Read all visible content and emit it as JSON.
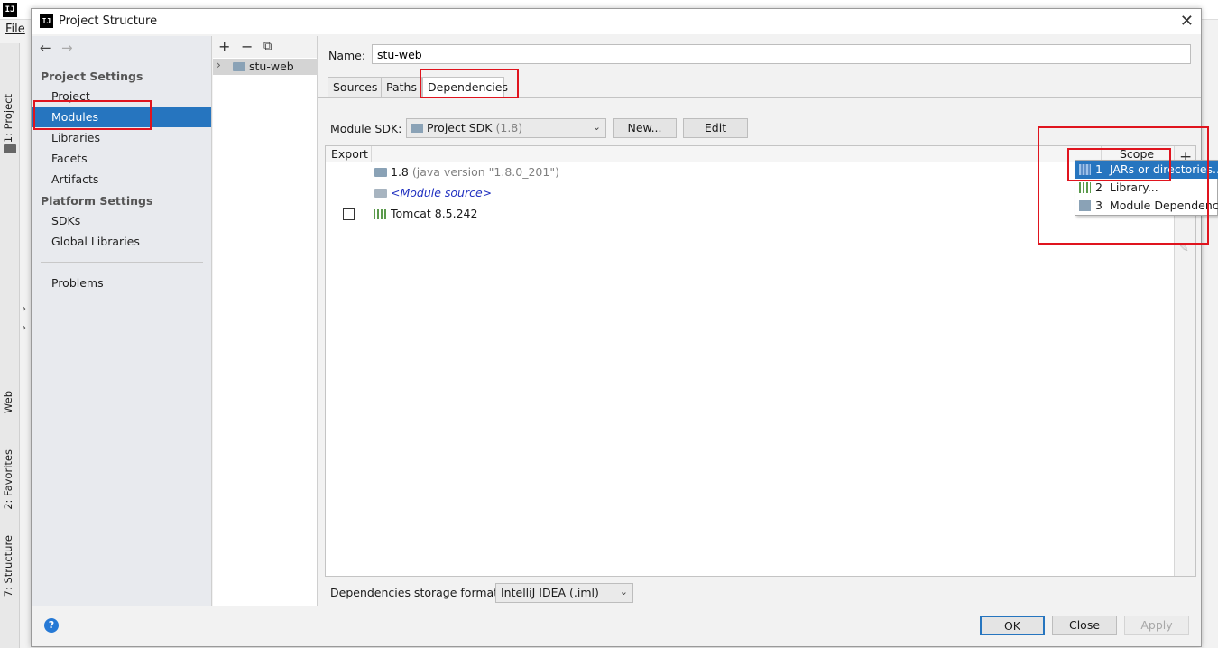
{
  "ide": {
    "logo": "IJ",
    "menu_file": "File",
    "vertical_tabs": [
      "1: Project",
      "Web",
      "2: Favorites",
      "7: Structure"
    ]
  },
  "dialog": {
    "title": "Project Structure",
    "logo": "IJ",
    "close": "✕"
  },
  "nav": {
    "back": "←",
    "forward": "→",
    "project_settings_header": "Project Settings",
    "project_settings": [
      "Project",
      "Modules",
      "Libraries",
      "Facets",
      "Artifacts"
    ],
    "platform_settings_header": "Platform Settings",
    "platform_settings": [
      "SDKs",
      "Global Libraries"
    ],
    "problems": "Problems",
    "selected": "Modules"
  },
  "tree": {
    "toolbar": [
      "+",
      "−",
      "⧉"
    ],
    "module": "stu-web"
  },
  "module": {
    "name_label": "Name:",
    "name_value": "stu-web",
    "tabs": [
      "Sources",
      "Paths",
      "Dependencies"
    ],
    "active_tab": "Dependencies",
    "sdk_label": "Module SDK:",
    "sdk_value": "Project SDK",
    "sdk_version": "(1.8)",
    "new_button": "New...",
    "edit_button": "Edit"
  },
  "dependencies": {
    "header_export": "Export",
    "header_scope": "Scope",
    "rows": [
      {
        "name": "1.8",
        "detail": "(java version \"1.8.0_201\")",
        "kind": "sdk"
      },
      {
        "name": "<Module source>",
        "detail": "",
        "kind": "source"
      },
      {
        "name": "Tomcat 8.5.242",
        "detail": "",
        "kind": "library"
      }
    ],
    "add_button": "+",
    "edit_icon": "pencil-icon"
  },
  "add_menu": {
    "items": [
      {
        "num": "1",
        "label": "JARs or directories..."
      },
      {
        "num": "2",
        "label": "Library..."
      },
      {
        "num": "3",
        "label": "Module Dependency..."
      }
    ]
  },
  "storage": {
    "label": "Dependencies storage format:",
    "value": "IntelliJ IDEA (.iml)"
  },
  "footer": {
    "help": "?",
    "ok": "OK",
    "close": "Close",
    "apply": "Apply"
  },
  "colors": {
    "selection": "#2675bf",
    "annotation": "#e0141e"
  }
}
